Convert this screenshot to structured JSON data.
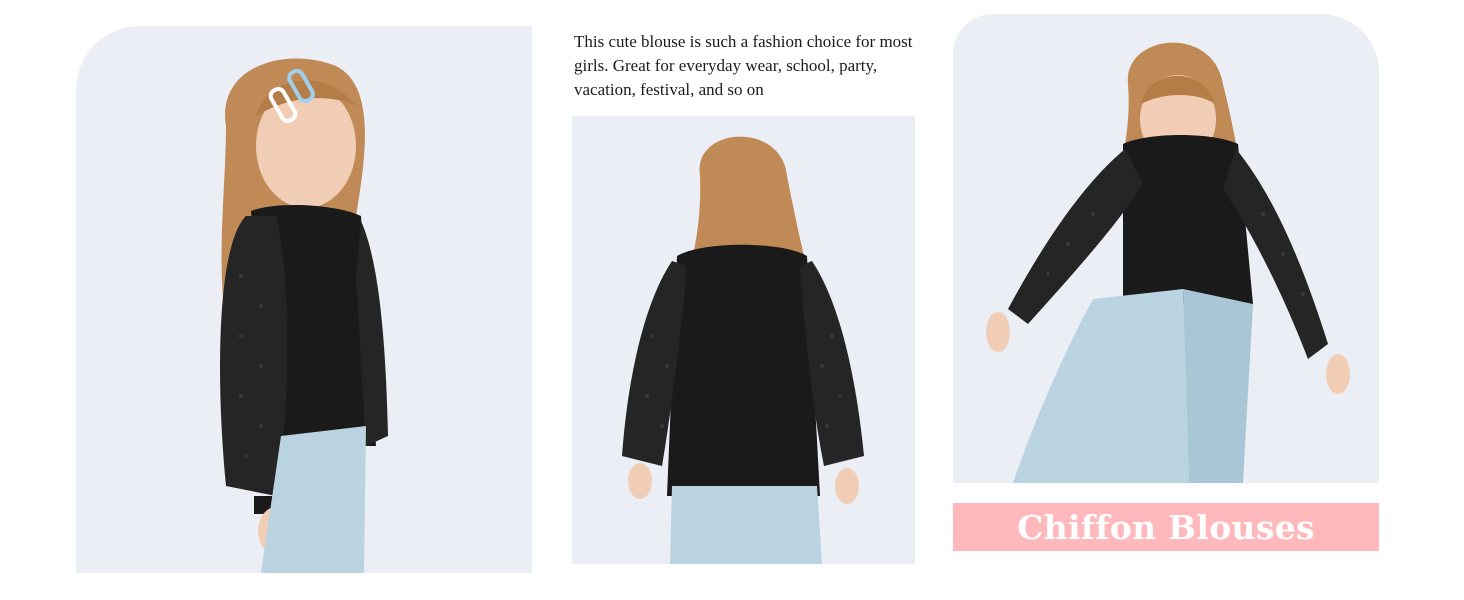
{
  "description": {
    "text": "This cute blouse is such a fashion choice for most girls. Great for everyday wear, school, party, vacation, festival, and so on"
  },
  "banner": {
    "label": "Chiffon Blouses",
    "background_color": "#ffb9bd",
    "text_color": "#ffffff"
  },
  "colors": {
    "panel_background": "#eceef5",
    "blouse": "#1a1a1a",
    "jeans": "#b9d3e0",
    "hair": "#c08a56",
    "skin": "#f1cdb5"
  },
  "photos": [
    {
      "content": "girl-front-side-view"
    },
    {
      "content": "girl-back-view"
    },
    {
      "content": "girl-front-view-arms-out"
    }
  ]
}
